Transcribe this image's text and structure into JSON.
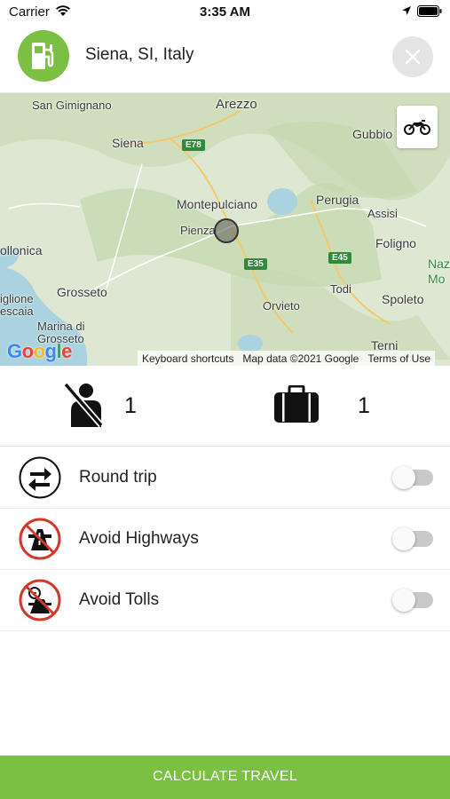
{
  "status_bar": {
    "carrier": "Carrier",
    "time": "3:35 AM"
  },
  "header": {
    "location": "Siena, SI, Italy",
    "fuel_icon": "fuel-pump-icon",
    "close_icon": "close-icon"
  },
  "map": {
    "labels": {
      "san_gimignano": "San Gimignano",
      "arezzo": "Arezzo",
      "gubbio": "Gubbio",
      "siena": "Siena",
      "montepulciano": "Montepulciano",
      "perugia": "Perugia",
      "assisi": "Assisi",
      "pienza": "Pienza",
      "foligno": "Foligno",
      "follonica": "ollonica",
      "grosseto": "Grosseto",
      "todi": "Todi",
      "spoleto": "Spoleto",
      "orvieto": "Orvieto",
      "castiglione": "iglione",
      "pescaia": "escaia",
      "marina": "Marina di",
      "grosseto2": "Grosseto",
      "terni": "Terni",
      "narni": "Naz",
      "narni2": "Mo"
    },
    "roads": {
      "e78": "E78",
      "e35": "E35",
      "e45": "E45"
    },
    "google_logo": "Google",
    "footer": {
      "shortcuts": "Keyboard shortcuts",
      "map_data": "Map data ©2021 Google",
      "terms": "Terms of Use"
    },
    "vehicle_icon": "motorcycle-icon"
  },
  "counters": {
    "passengers": {
      "icon": "passenger-seatbelt-icon",
      "value": "1"
    },
    "luggage": {
      "icon": "suitcase-icon",
      "value": "1"
    }
  },
  "options": [
    {
      "label": "Round trip",
      "icon": "round-trip-icon",
      "enabled": false
    },
    {
      "label": "Avoid Highways",
      "icon": "no-highway-icon",
      "enabled": false
    },
    {
      "label": "Avoid Tolls",
      "icon": "no-toll-icon",
      "enabled": false
    }
  ],
  "calculate_button": "CALCULATE TRAVEL",
  "colors": {
    "accent": "#7cc043",
    "toggle_off": "#c9c9c9",
    "prohibited": "#d0392b"
  }
}
